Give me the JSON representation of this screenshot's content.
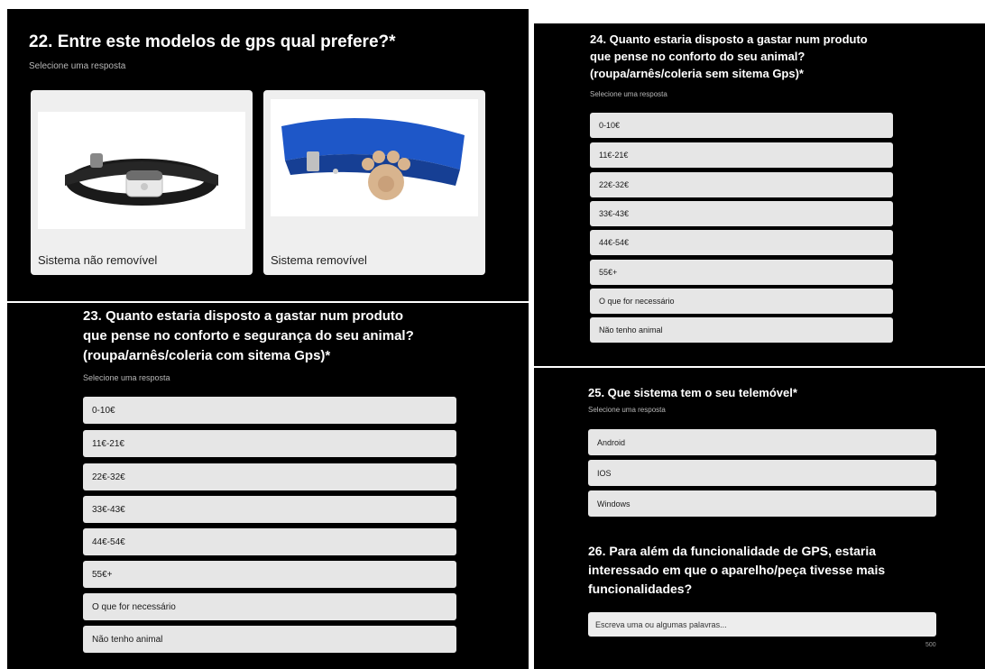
{
  "q22": {
    "title": "22. Entre este modelos de gps qual prefere?*",
    "subtitle": "Selecione uma resposta",
    "options": [
      "Sistema não removível",
      "Sistema removível"
    ],
    "images": [
      "black-collar-with-gps-device-image",
      "blue-collar-with-paw-gps-image"
    ]
  },
  "q23": {
    "title_lines": [
      "23. Quanto estaria disposto a gastar num produto",
      "que pense no conforto e segurança do seu animal?",
      "(roupa/arnês/coleria com sitema Gps)*"
    ],
    "subtitle": "Selecione uma resposta",
    "options": [
      "0-10€",
      "11€-21€",
      "22€-32€",
      "33€-43€",
      "44€-54€",
      "55€+",
      "O que for necessário",
      "Não tenho animal"
    ]
  },
  "q24": {
    "title_lines": [
      "24. Quanto estaria disposto a gastar num produto",
      "que pense no conforto do seu animal?",
      "(roupa/arnês/coleria sem sitema Gps)*"
    ],
    "subtitle": "Selecione uma resposta",
    "options": [
      "0-10€",
      "11€-21€",
      "22€-32€",
      "33€-43€",
      "44€-54€",
      "55€+",
      "O que for necessário",
      "Não tenho animal"
    ]
  },
  "q25": {
    "title": "25. Que sistema tem o seu telemóvel*",
    "subtitle": "Selecione uma resposta",
    "options": [
      "Android",
      "IOS",
      "Windows"
    ]
  },
  "q26": {
    "title_lines": [
      "26. Para além da funcionalidade de GPS, estaria",
      "interessado em que o aparelho/peça tivesse mais",
      "funcionalidades?"
    ],
    "placeholder": "Escreva uma ou algumas palavras...",
    "counter": "500"
  },
  "colors": {
    "panel_bg": "#000000",
    "option_bg": "#e6e6e6",
    "subtitle": "#b8b8b8"
  }
}
